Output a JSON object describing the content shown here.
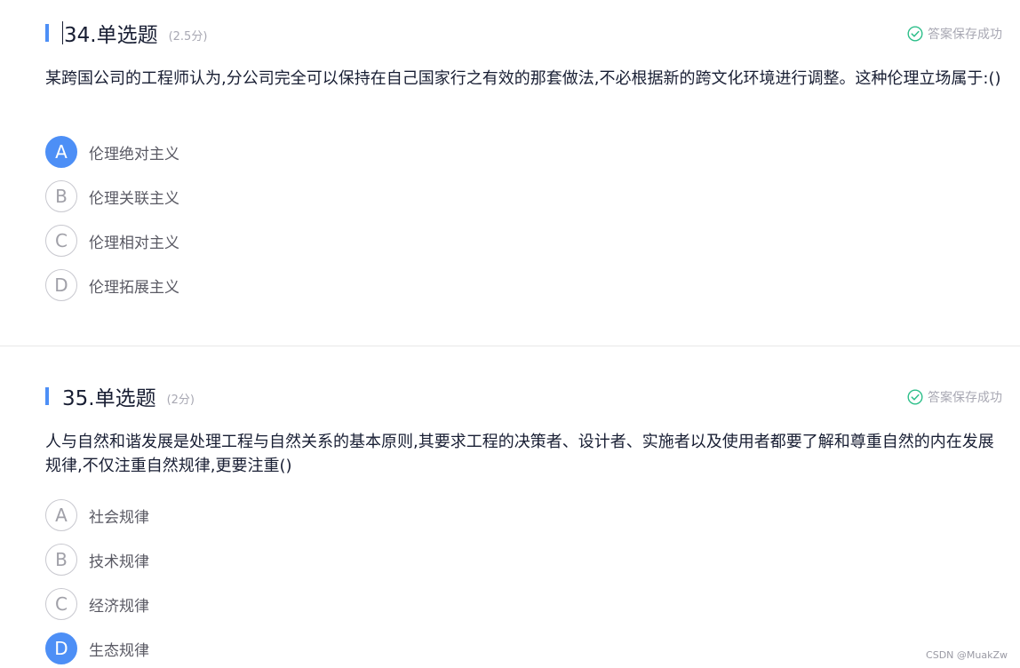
{
  "accent_color": "#4d8ff6",
  "success_color": "#2dbf8a",
  "questions": [
    {
      "number_title": "34.单选题",
      "score": "(2.5分)",
      "status": "答案保存成功",
      "status_icon": "check-circle-icon",
      "stem": "某跨国公司的工程师认为,分公司完全可以保持在自己国家行之有效的那套做法,不必根据新的跨文化环境进行调整。这种伦理立场属于:()",
      "selected": "A",
      "options": [
        {
          "letter": "A",
          "text": "伦理绝对主义"
        },
        {
          "letter": "B",
          "text": "伦理关联主义"
        },
        {
          "letter": "C",
          "text": "伦理相对主义"
        },
        {
          "letter": "D",
          "text": "伦理拓展主义"
        }
      ]
    },
    {
      "number_title": "35.单选题",
      "score": "(2分)",
      "status": "答案保存成功",
      "status_icon": "check-circle-icon",
      "stem": "人与自然和谐发展是处理工程与自然关系的基本原则,其要求工程的决策者、设计者、实施者以及使用者都要了解和尊重自然的内在发展规律,不仅注重自然规律,更要注重()",
      "selected": "D",
      "options": [
        {
          "letter": "A",
          "text": "社会规律"
        },
        {
          "letter": "B",
          "text": "技术规律"
        },
        {
          "letter": "C",
          "text": "经济规律"
        },
        {
          "letter": "D",
          "text": "生态规律"
        }
      ]
    }
  ],
  "watermark": "CSDN @MuakZw"
}
